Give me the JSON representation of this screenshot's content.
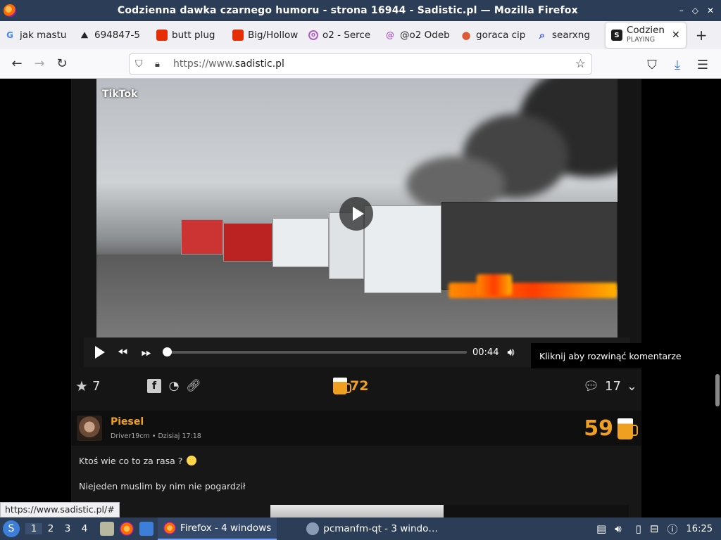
{
  "window": {
    "title": "Codzienna dawka czarnego humoru - strona 16944 - Sadistic.pl — Mozilla Firefox",
    "controls": [
      "–",
      "◇",
      "✕"
    ]
  },
  "tabs": [
    {
      "label": "jak mastu",
      "icon": "google-icon",
      "color": "#4285f4",
      "glyph": "G"
    },
    {
      "label": "694847-5",
      "icon": "site-icon",
      "color": "#222222",
      "glyph": "⛰"
    },
    {
      "label": "butt plug",
      "icon": "aliexpress-icon",
      "color": "#e62e04",
      "glyph": "⬛"
    },
    {
      "label": "Big/Hollow",
      "icon": "aliexpress-icon",
      "color": "#e62e04",
      "glyph": "⬛"
    },
    {
      "label": "o2 - Serce",
      "icon": "o2-icon",
      "color": "#b05cc8",
      "glyph": "o"
    },
    {
      "label": "@o2 Odeb",
      "icon": "o2-icon",
      "color": "#b05cc8",
      "glyph": "@"
    },
    {
      "label": "goraca cip",
      "icon": "duckduckgo-icon",
      "color": "#de5833",
      "glyph": "●"
    },
    {
      "label": "searxng",
      "icon": "search-icon",
      "color": "#3050ff",
      "glyph": "⌕"
    }
  ],
  "active_tab": {
    "label": "Codzien",
    "sublabel": "PLAYING",
    "close": "✕"
  },
  "new_tab": "+",
  "nav": {
    "back": "←",
    "forward": "→",
    "reload": "↻",
    "url_prefix": "https://www.",
    "url_domain": "sadistic.pl",
    "bookmark": "☆",
    "pocket": "⛉",
    "downloads": "⤓",
    "menu": "☰"
  },
  "video": {
    "watermark": "TikTok",
    "watermark_sub": "",
    "time": "00:44",
    "progress": 0.0
  },
  "tooltip": "Kliknij aby rozwinąć komentarze",
  "post_actions": {
    "favorites": "7",
    "beers": "72",
    "comments": "17"
  },
  "comment": {
    "author": "Piesel",
    "meta": "Driver19cm • Dzisiaj 17:18",
    "score": "59",
    "line1": "Ktoś wie co to za rasa ?",
    "line2": "Niejeden muslim by nim nie pogardził"
  },
  "status_url": "https://www.sadistic.pl/#",
  "taskbar": {
    "workspaces": [
      "1",
      "2",
      "3",
      "4"
    ],
    "current_workspace": "1",
    "tasks": [
      {
        "label": "Firefox - 4 windows",
        "active": true
      },
      {
        "label": "pcmanfm-qt - 3 windo…",
        "active": false
      }
    ],
    "clock": "16:25"
  },
  "colors": {
    "accent": "#f0a020",
    "titlebar": "#2c3e57",
    "taskbar": "#2c3e57"
  }
}
